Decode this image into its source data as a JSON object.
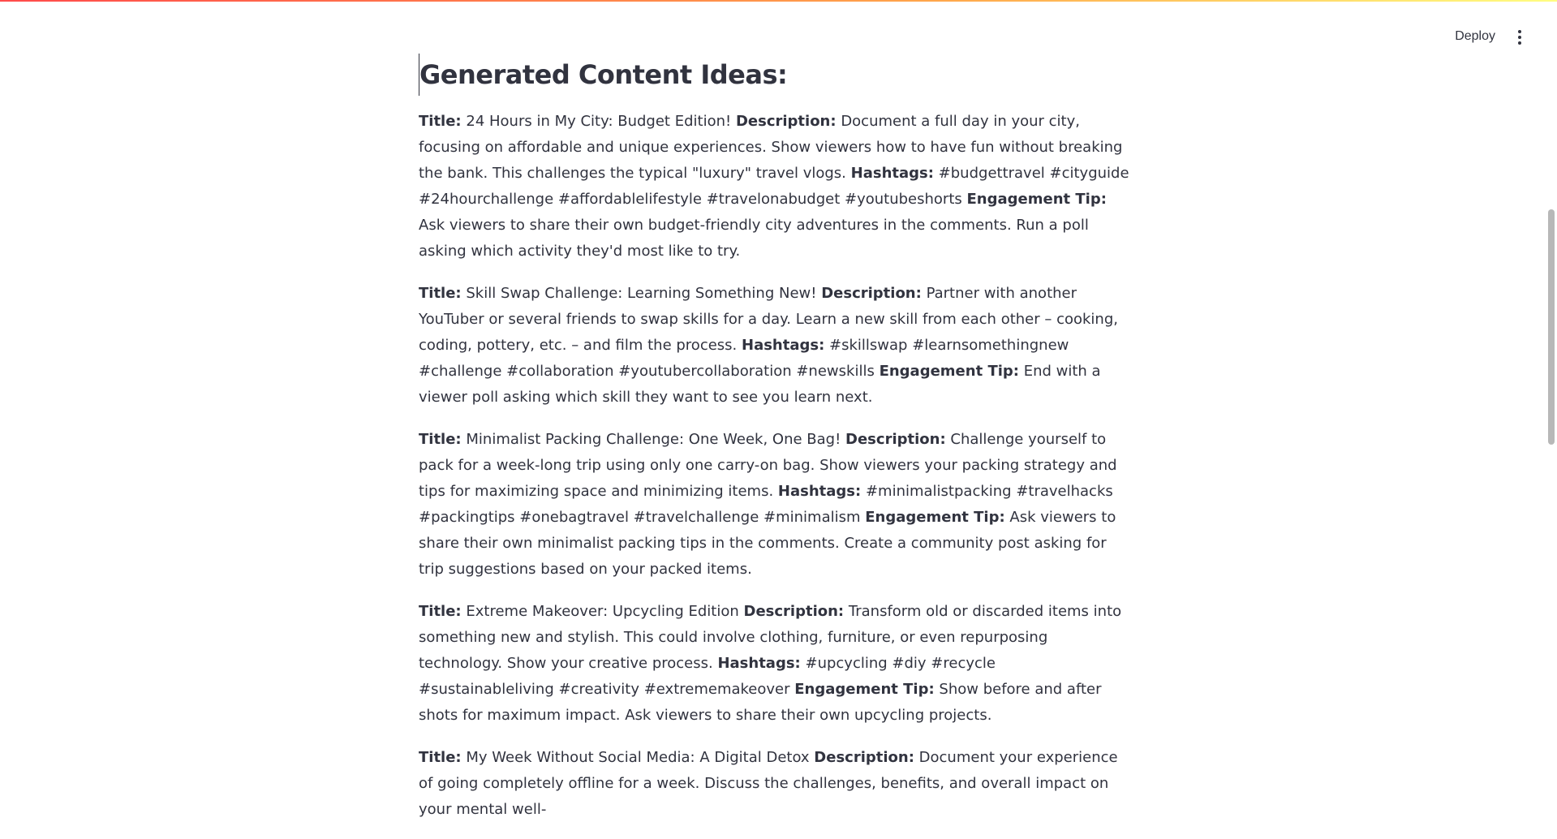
{
  "header": {
    "deploy_label": "Deploy",
    "menu_icon": "vertical-ellipsis-icon"
  },
  "main": {
    "heading": "Generated Content Ideas:",
    "labels": {
      "title": "Title:",
      "description": "Description:",
      "hashtags": "Hashtags:",
      "engagement": "Engagement Tip:"
    },
    "ideas": [
      {
        "title": "24 Hours in My City: Budget Edition!",
        "description": "Document a full day in your city, focusing on affordable and unique experiences. Show viewers how to have fun without breaking the bank. This challenges the typical \"luxury\" travel vlogs.",
        "hashtags": "#budgettravel #cityguide #24hourchallenge #affordablelifestyle #travelonabudget #youtubeshorts",
        "engagement": "Ask viewers to share their own budget-friendly city adventures in the comments. Run a poll asking which activity they'd most like to try."
      },
      {
        "title": "Skill Swap Challenge: Learning Something New!",
        "description": "Partner with another YouTuber or several friends to swap skills for a day. Learn a new skill from each other – cooking, coding, pottery, etc. – and film the process.",
        "hashtags": "#skillswap #learnsomethingnew #challenge #collaboration #youtubercollaboration #newskills",
        "engagement": "End with a viewer poll asking which skill they want to see you learn next."
      },
      {
        "title": "Minimalist Packing Challenge: One Week, One Bag!",
        "description": "Challenge yourself to pack for a week-long trip using only one carry-on bag. Show viewers your packing strategy and tips for maximizing space and minimizing items.",
        "hashtags": "#minimalistpacking #travelhacks #packingtips #onebagtravel #travelchallenge #minimalism",
        "engagement": "Ask viewers to share their own minimalist packing tips in the comments. Create a community post asking for trip suggestions based on your packed items."
      },
      {
        "title": "Extreme Makeover: Upcycling Edition",
        "description": "Transform old or discarded items into something new and stylish. This could involve clothing, furniture, or even repurposing technology. Show your creative process.",
        "hashtags": "#upcycling #diy #recycle #sustainableliving #creativity #extrememakeover",
        "engagement": "Show before and after shots for maximum impact. Ask viewers to share their own upcycling projects."
      },
      {
        "title": "My Week Without Social Media: A Digital Detox",
        "description": "Document your experience of going completely offline for a week. Discuss the challenges, benefits, and overall impact on your mental well-",
        "hashtags": "",
        "engagement": ""
      }
    ]
  },
  "colors": {
    "text": "#31333f",
    "background": "#ffffff",
    "gradient_start": "#ff4b4b",
    "gradient_end": "#fffd80"
  }
}
